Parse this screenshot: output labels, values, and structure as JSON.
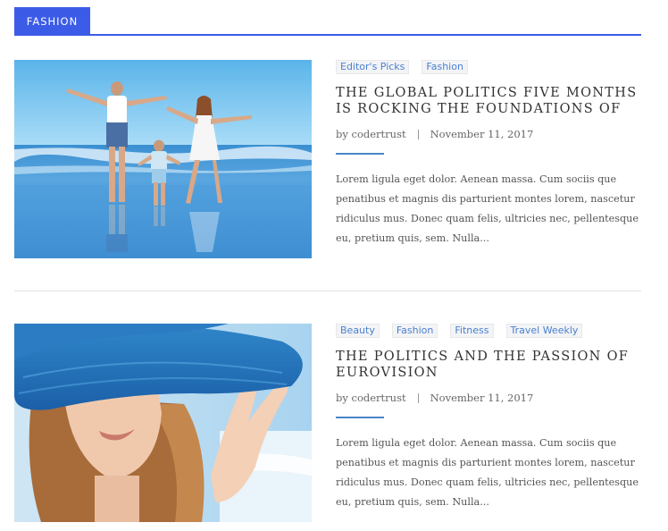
{
  "section": {
    "label": "FASHION"
  },
  "posts": [
    {
      "tags": [
        "Editor's Picks",
        "Fashion"
      ],
      "title": "THE GLOBAL POLITICS FIVE MONTHS IS ROCKING THE FOUNDATIONS OF",
      "author": "by codertrust",
      "date": "November 11, 2017",
      "excerpt": "Lorem ligula eget dolor. Aenean massa. Cum sociis que penatibus et magnis dis parturient montes lorem, nascetur ridiculus mus. Donec quam felis, ultricies nec, pellentesque eu, pretium quis, sem. Nulla..."
    },
    {
      "tags": [
        "Beauty",
        "Fashion",
        "Fitness",
        "Travel Weekly"
      ],
      "title": "THE POLITICS AND THE PASSION OF EUROVISION",
      "author": "by codertrust",
      "date": "November 11, 2017",
      "excerpt": "Lorem ligula eget dolor. Aenean massa. Cum sociis que penatibus et magnis dis parturient montes lorem, nascetur ridiculus mus. Donec quam felis, ultricies nec, pellentesque eu, pretium quis, sem. Nulla..."
    }
  ],
  "colors": {
    "accent": "#3c5ce8",
    "tag_text": "#4a7fd0",
    "meta_rule": "#4a86c8"
  }
}
